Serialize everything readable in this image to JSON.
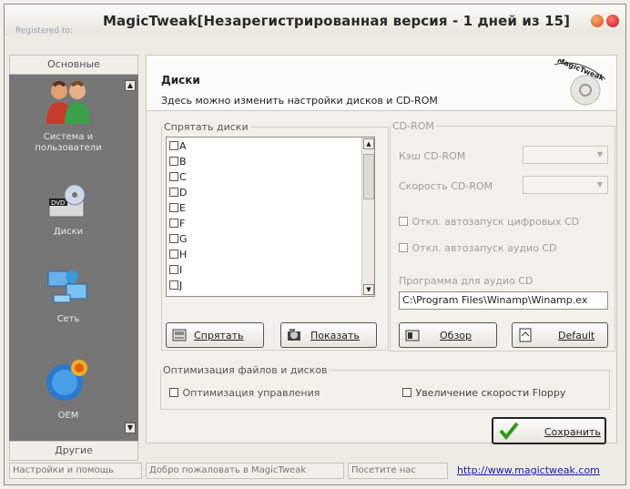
{
  "window": {
    "title": "MagicTweak[Незарегистрированная версия - 1 дней из 15]",
    "subtitle": "Registered to:"
  },
  "sidebar": {
    "top_tab": "Основные",
    "bottom_tab": "Другие",
    "items": [
      {
        "label": "Система и пользователи",
        "icon": "users-icon"
      },
      {
        "label": "Диски",
        "icon": "dvd-drive-icon"
      },
      {
        "label": "Сеть",
        "icon": "network-icon"
      },
      {
        "label": "OEM",
        "icon": "oem-icon"
      }
    ]
  },
  "header": {
    "title": "Диски",
    "description": "Здесь можно изменить настройки дисков и CD-ROM",
    "logo_text": "MagicTweak"
  },
  "hide_disks": {
    "legend": "Спрятать диски",
    "drives": [
      "A",
      "B",
      "C",
      "D",
      "E",
      "F",
      "G",
      "H",
      "I",
      "J"
    ],
    "hide_button": "Спрятать",
    "show_button": "Показать"
  },
  "cdrom": {
    "legend": "CD-ROM",
    "cache_label": "Кэш CD-ROM",
    "speed_label": "Скорость CD-ROM",
    "autorun_digital": "Откл. автозапуск цифровых CD",
    "autorun_audio": "Откл. автозапуск аудио CD",
    "audio_program_label": "Программа для аудио CD",
    "audio_program_path": "C:\\Program Files\\Winamp\\Winamp.ex",
    "browse_button": "Обзор",
    "default_button": "Default"
  },
  "optimization": {
    "legend": "Оптимизация файлов и дисков",
    "control_opt": "Оптимизация управления",
    "floppy_speed": "Увеличение скорости Floppy"
  },
  "save_button": "Сохранить",
  "statusbar": {
    "settings_help": "Настройки и помощь",
    "welcome": "Добро пожаловать в MagicTweak",
    "visit": "Посетите нас",
    "url": "http://www.magictweak.com"
  },
  "colors": {
    "sidebar_bg": "#767676",
    "link": "#1a1aa8",
    "save_check": "#2f9a1e"
  }
}
